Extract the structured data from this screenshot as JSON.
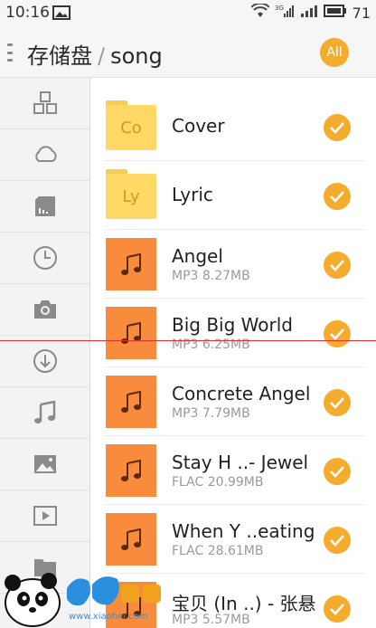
{
  "status_bar": {
    "time": "10:16",
    "network": "3G",
    "battery": "71"
  },
  "header": {
    "root": "存储盘",
    "separator": "/",
    "folder": "song",
    "all_label": "All"
  },
  "sidebar": {
    "items": [
      {
        "icon": "category-icon"
      },
      {
        "icon": "cloud-icon"
      },
      {
        "icon": "sd-card-icon"
      },
      {
        "icon": "clock-icon"
      },
      {
        "icon": "camera-icon"
      },
      {
        "icon": "download-icon"
      },
      {
        "icon": "music-icon"
      },
      {
        "icon": "image-icon"
      },
      {
        "icon": "video-icon"
      },
      {
        "icon": "folder-icon"
      }
    ]
  },
  "files": [
    {
      "kind": "folder",
      "thumb_text": "Co",
      "name": "Cover",
      "meta": "",
      "selected": true
    },
    {
      "kind": "folder",
      "thumb_text": "Ly",
      "name": "Lyric",
      "meta": "",
      "selected": true
    },
    {
      "kind": "audio",
      "thumb_text": "",
      "name": "Angel",
      "meta": "MP3 8.27MB",
      "selected": true
    },
    {
      "kind": "audio",
      "thumb_text": "",
      "name": "Big Big World",
      "meta": "MP3 6.25MB",
      "selected": true
    },
    {
      "kind": "audio",
      "thumb_text": "",
      "name": "Concrete Angel",
      "meta": "MP3 7.79MB",
      "selected": true
    },
    {
      "kind": "audio",
      "thumb_text": "",
      "name": "Stay H ..- Jewel",
      "meta": "FLAC 20.99MB",
      "selected": true
    },
    {
      "kind": "audio",
      "thumb_text": "",
      "name": "When Y ..eating",
      "meta": "FLAC 28.61MB",
      "selected": true
    },
    {
      "kind": "audio",
      "thumb_text": "",
      "name": "宝贝 (In ..) - 张悬",
      "meta": "MP3 5.57MB",
      "selected": true
    }
  ],
  "watermark": {
    "text": "www.xiaohei.com"
  },
  "colors": {
    "accent": "#f3ac2c",
    "folder": "#ffd866",
    "audio_tile": "#f98b3c"
  }
}
